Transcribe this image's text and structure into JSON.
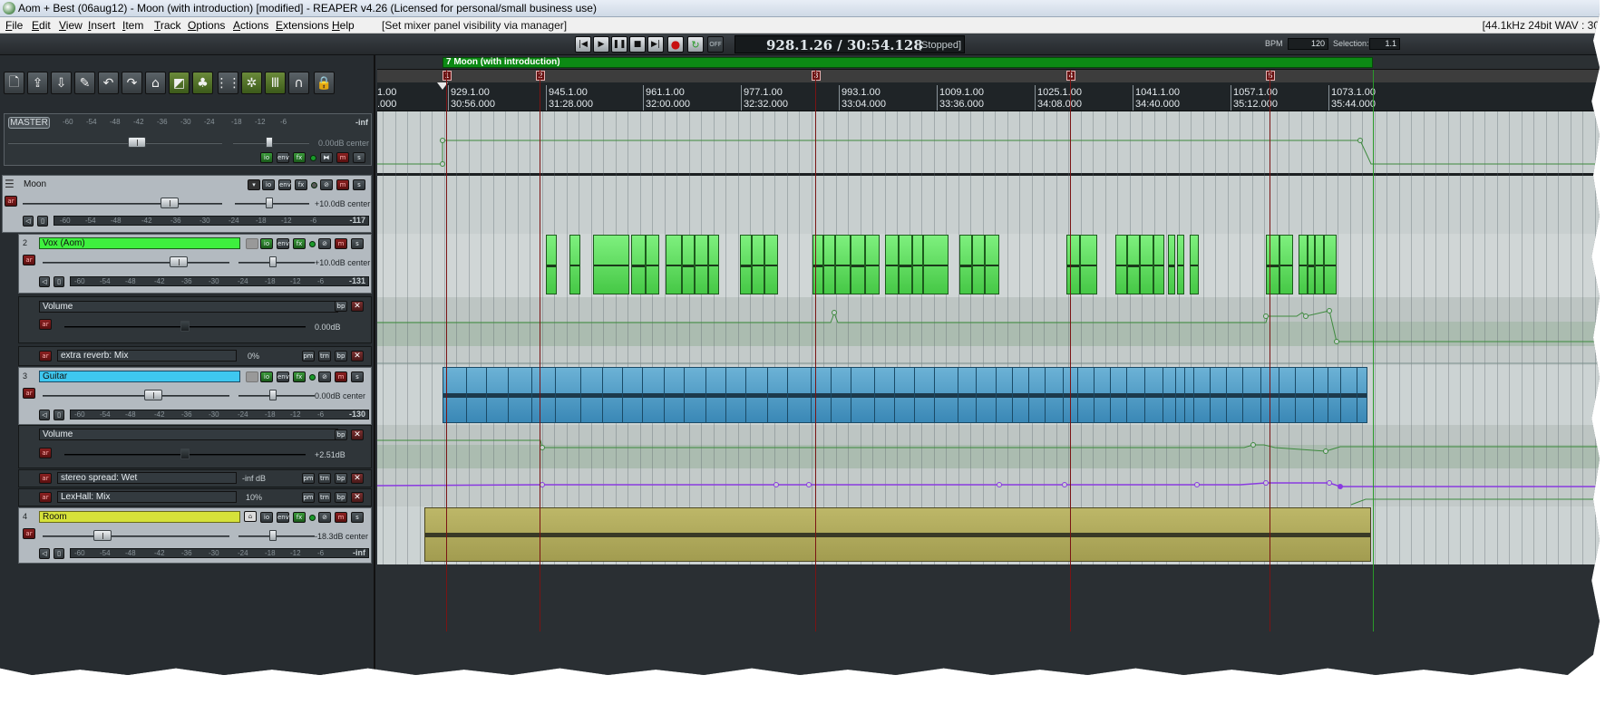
{
  "window": {
    "title": "Aom + Best (06aug12) - Moon (with introduction) [modified] - REAPER v4.26 (Licensed for personal/small business use)"
  },
  "menu": {
    "items": [
      "File",
      "Edit",
      "View",
      "Insert",
      "Item",
      "Track",
      "Options",
      "Actions",
      "Extensions",
      "Help"
    ],
    "action_status": "[Set mixer panel visibility via manager]",
    "format": "[44.1kHz 24bit WAV : 30"
  },
  "transport": {
    "buttons": [
      "skip-to-start",
      "play",
      "pause",
      "stop",
      "skip-to-end",
      "record",
      "repeat",
      "auto-crossfade-off"
    ],
    "off_label": "OFF",
    "position": "928.1.26 / 30:54.128",
    "state": "[Stopped]",
    "bpm_label": "BPM",
    "bpm_value": "120",
    "selection_label": "Selection:",
    "selection_value": "1.1"
  },
  "toolbar": {
    "tools": [
      "new-project",
      "open-project",
      "save-project",
      "project-settings",
      "undo",
      "redo",
      "metronome",
      "ripple-edit",
      "grouping",
      "snap-grid",
      "autoscroll",
      "envelope-lock",
      "magnet",
      "lock"
    ]
  },
  "master": {
    "label": "MASTER",
    "volume": "0.00dB center",
    "peak": "-inf",
    "scale": [
      "-60",
      "-54",
      "-48",
      "-42",
      "-36",
      "-30",
      "-24",
      "-18",
      "-12",
      "-6"
    ]
  },
  "tracks": [
    {
      "number": "",
      "name": "Moon",
      "color": "#2f3539",
      "volume": "+10.0dB center",
      "peak": "-117"
    },
    {
      "number": "2",
      "name": "Vox (Aom)",
      "color": "#3ef03e",
      "volume": "+10.0dB center",
      "peak": "-131"
    },
    {
      "number": "3",
      "name": "Guitar",
      "color": "#3ec8f0",
      "volume": "0.00dB center",
      "peak": "-130"
    },
    {
      "number": "4",
      "name": "Room",
      "color": "#d6e23a",
      "volume": "-18.3dB center",
      "peak": "-inf"
    }
  ],
  "envelopes": {
    "vox_volume": {
      "name": "Volume",
      "value": "0.00dB"
    },
    "vox_reverb": {
      "name": "extra reverb: Mix",
      "value": "0%"
    },
    "guitar_volume": {
      "name": "Volume",
      "value": "+2.51dB"
    },
    "guitar_spread": {
      "name": "stereo spread: Wet",
      "value": "-inf dB"
    },
    "guitar_lexhall": {
      "name": "LexHall: Mix",
      "value": "10%"
    }
  },
  "buttons": {
    "io": "io",
    "env": "env",
    "fx": "fx",
    "mute": "m",
    "solo": "s",
    "arm": "ar",
    "bypass": "bp",
    "parameter": "pm",
    "trim": "trn"
  },
  "region": {
    "label": "7 Moon (with introduction)"
  },
  "markers": [
    "1",
    "2",
    "3",
    "4",
    "5"
  ],
  "ruler": [
    {
      "bar": "1.00",
      "time": ".000"
    },
    {
      "bar": "929.1.00",
      "time": "30:56.000"
    },
    {
      "bar": "945.1.00",
      "time": "31:28.000"
    },
    {
      "bar": "961.1.00",
      "time": "32:00.000"
    },
    {
      "bar": "977.1.00",
      "time": "32:32.000"
    },
    {
      "bar": "993.1.00",
      "time": "33:04.000"
    },
    {
      "bar": "1009.1.00",
      "time": "33:36.000"
    },
    {
      "bar": "1025.1.00",
      "time": "34:08.000"
    },
    {
      "bar": "1041.1.00",
      "time": "34:40.000"
    },
    {
      "bar": "1057.1.00",
      "time": "35:12.000"
    },
    {
      "bar": "1073.1.00",
      "time": "35:44.000"
    }
  ],
  "colors": {
    "vox_item": "#4ed84e",
    "guitar_item": "#4a9cc8",
    "room_item": "#b2ac5c",
    "envelope": "#3e8a3e",
    "envelope_purple": "#8a3ae0",
    "marker": "#7a1414",
    "region": "#0c8a14"
  }
}
